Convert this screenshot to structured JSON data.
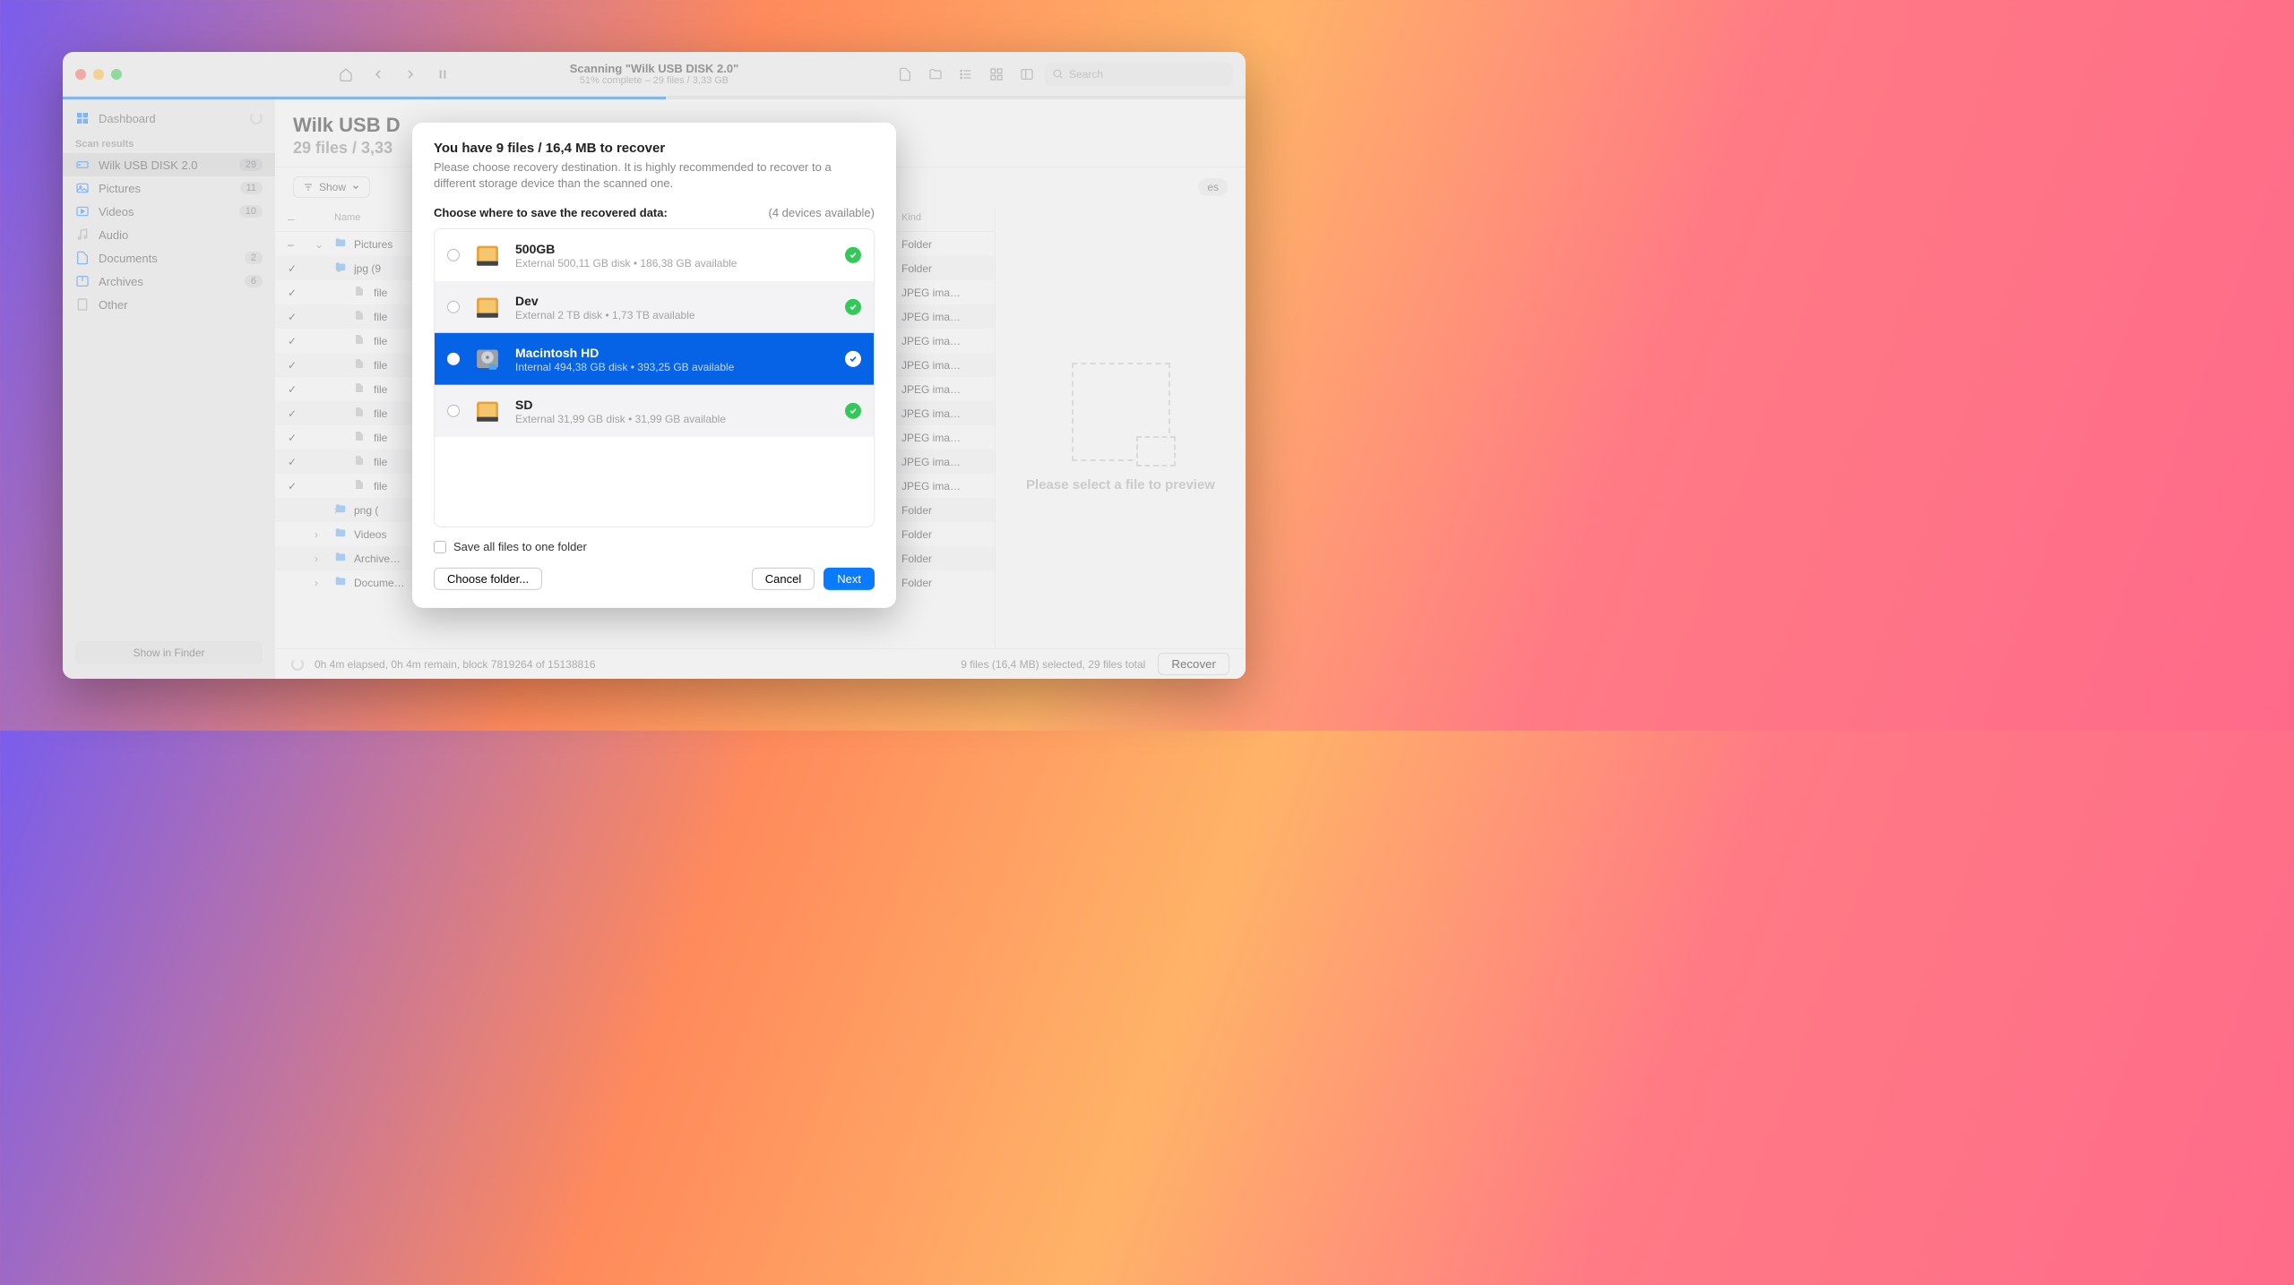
{
  "titlebar": {
    "title": "Scanning \"Wilk USB DISK 2.0\"",
    "subtitle": "51% complete – 29 files / 3,33 GB",
    "search_placeholder": "Search"
  },
  "progress_percent": 51,
  "sidebar": {
    "dashboard": "Dashboard",
    "section_header": "Scan results",
    "items": [
      {
        "label": "Wilk USB DISK 2.0",
        "badge": "29",
        "active": true,
        "icon": "drive"
      },
      {
        "label": "Pictures",
        "badge": "11",
        "icon": "pictures"
      },
      {
        "label": "Videos",
        "badge": "10",
        "icon": "videos"
      },
      {
        "label": "Audio",
        "badge": "",
        "icon": "audio"
      },
      {
        "label": "Documents",
        "badge": "2",
        "icon": "documents"
      },
      {
        "label": "Archives",
        "badge": "6",
        "icon": "archives"
      },
      {
        "label": "Other",
        "badge": "",
        "icon": "other"
      }
    ],
    "show_in_finder": "Show in Finder"
  },
  "main": {
    "title": "Wilk USB D",
    "subtitle": "29 files / 3,33",
    "show_label": "Show",
    "pills": [
      "es"
    ],
    "columns": {
      "name": "Name",
      "kind": "Kind"
    },
    "rows": [
      {
        "check": "–",
        "arrow": "⌄",
        "indent": 0,
        "icon": "folder",
        "name": "Pictures",
        "kind": "Folder"
      },
      {
        "check": "✓",
        "arrow": "⌄",
        "indent": 1,
        "icon": "folder",
        "name": "jpg (9",
        "kind": "Folder"
      },
      {
        "check": "✓",
        "arrow": "",
        "indent": 2,
        "icon": "file",
        "name": "file",
        "kind": "JPEG ima…"
      },
      {
        "check": "✓",
        "arrow": "",
        "indent": 2,
        "icon": "file",
        "name": "file",
        "kind": "JPEG ima…"
      },
      {
        "check": "✓",
        "arrow": "",
        "indent": 2,
        "icon": "file",
        "name": "file",
        "kind": "JPEG ima…"
      },
      {
        "check": "✓",
        "arrow": "",
        "indent": 2,
        "icon": "file",
        "name": "file",
        "kind": "JPEG ima…"
      },
      {
        "check": "✓",
        "arrow": "",
        "indent": 2,
        "icon": "file",
        "name": "file",
        "kind": "JPEG ima…"
      },
      {
        "check": "✓",
        "arrow": "",
        "indent": 2,
        "icon": "file",
        "name": "file",
        "kind": "JPEG ima…"
      },
      {
        "check": "✓",
        "arrow": "",
        "indent": 2,
        "icon": "file",
        "name": "file",
        "kind": "JPEG ima…"
      },
      {
        "check": "✓",
        "arrow": "",
        "indent": 2,
        "icon": "file",
        "name": "file",
        "kind": "JPEG ima…"
      },
      {
        "check": "✓",
        "arrow": "",
        "indent": 2,
        "icon": "file",
        "name": "file",
        "kind": "JPEG ima…"
      },
      {
        "check": "",
        "arrow": "›",
        "indent": 1,
        "icon": "folder",
        "name": "png (",
        "kind": "Folder"
      },
      {
        "check": "",
        "arrow": "›",
        "indent": 0,
        "icon": "folder",
        "name": "Videos",
        "kind": "Folder"
      },
      {
        "check": "",
        "arrow": "›",
        "indent": 0,
        "icon": "folder",
        "name": "Archive…",
        "kind": "Folder"
      },
      {
        "check": "",
        "arrow": "›",
        "indent": 0,
        "icon": "folder",
        "name": "Docume…",
        "kind": "Folder"
      }
    ],
    "preview_text": "Please select a file to preview"
  },
  "status": {
    "left": "0h 4m elapsed, 0h 4m remain, block 7819264 of 15138816",
    "right": "9 files (16,4 MB) selected, 29 files total",
    "recover": "Recover"
  },
  "modal": {
    "title": "You have 9 files / 16,4 MB to recover",
    "desc": "Please choose recovery destination. It is highly recommended to recover to a different storage device than the scanned one.",
    "choose_label": "Choose where to save the recovered data:",
    "devices_available": "(4 devices available)",
    "devices": [
      {
        "name": "500GB",
        "sub": "External 500,11 GB disk • 186,38 GB available",
        "selected": false,
        "type": "external"
      },
      {
        "name": "Dev",
        "sub": "External 2 TB disk • 1,73 TB available",
        "selected": false,
        "type": "external"
      },
      {
        "name": "Macintosh HD",
        "sub": "Internal 494,38 GB disk • 393,25 GB available",
        "selected": true,
        "type": "internal"
      },
      {
        "name": "SD",
        "sub": "External 31,99 GB disk • 31,99 GB available",
        "selected": false,
        "type": "external"
      }
    ],
    "save_checkbox": "Save all files to one folder",
    "choose_folder": "Choose folder...",
    "cancel": "Cancel",
    "next": "Next"
  }
}
